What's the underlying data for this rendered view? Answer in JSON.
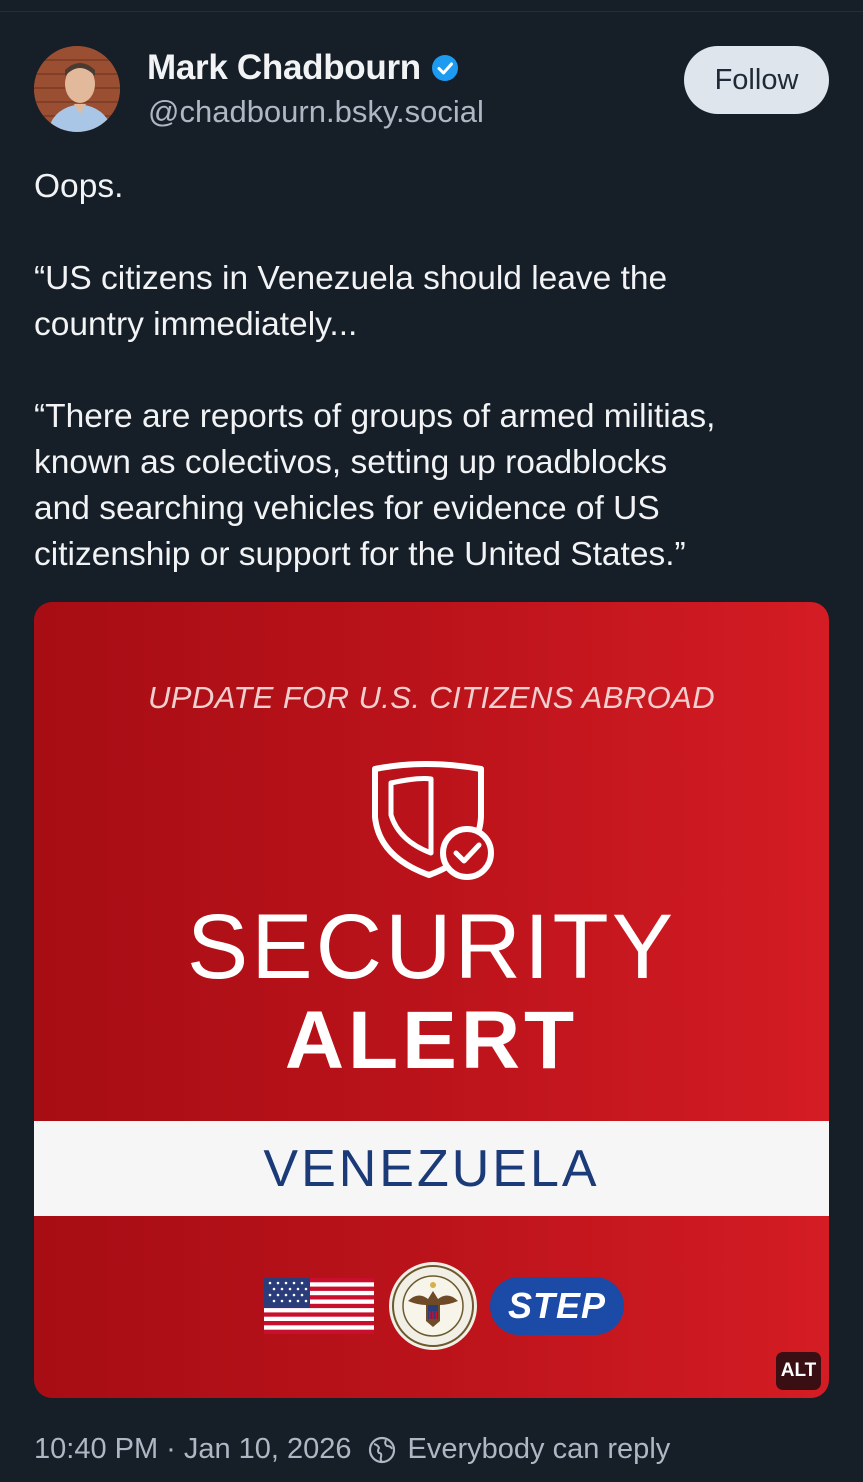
{
  "author": {
    "name": "Mark Chadbourn",
    "handle": "@chadbourn.bsky.social",
    "verified": true
  },
  "follow_button": "Follow",
  "post": {
    "paragraphs": [
      [
        "Oops."
      ],
      [
        "“US citizens in Venezuela should leave the",
        "country immediately..."
      ],
      [
        "“There are reports of groups of armed militias,",
        "known as colectivos, setting up roadblocks",
        "and searching vehicles for evidence of US",
        "citizenship or support for the United States.”"
      ]
    ]
  },
  "image": {
    "header": "UPDATE FOR U.S. CITIZENS ABROAD",
    "title_line1": "SECURITY",
    "title_line2": "ALERT",
    "country": "VENEZUELA",
    "step_logo": "STEP",
    "alt_badge": "ALT",
    "icons": [
      "shield-check-icon",
      "us-flag",
      "state-department-seal"
    ]
  },
  "meta": {
    "time": "10:40 PM",
    "date": "Jan 10, 2026",
    "reply_setting": "Everybody can reply"
  },
  "colors": {
    "background": "#161e27",
    "verified": "#1d9bf0",
    "card_red": "#c0141c",
    "navy": "#1b3a78"
  }
}
